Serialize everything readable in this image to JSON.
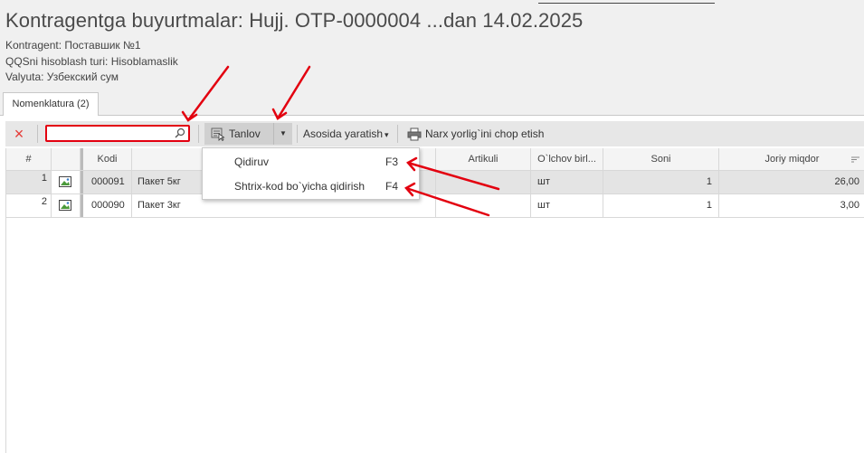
{
  "window": {
    "title": "Kontragentga buyurtmalar: Hujj. OTP-0000004 ...dan 14.02.2025"
  },
  "info": {
    "contragent": "Kontragent: Поставшик №1",
    "calc_type": "QQSni hisoblash turi: Hisoblamaslik",
    "currency": "Valyuta: Узбекский сум"
  },
  "tabs": [
    {
      "label": "Nomenklatura (2)",
      "active": true
    }
  ],
  "toolbar": {
    "delete_icon": "×",
    "search": {
      "value": "",
      "placeholder": ""
    },
    "tanlov_label": "Tanlov",
    "tanlov_arrow": "▼",
    "asosida_label": "Asosida yaratish",
    "asosida_arrow": "▾",
    "narx_label": "Narx yorlig`ini chop etish"
  },
  "dropdown": {
    "items": [
      {
        "label": "Qidiruv",
        "shortcut": "F3"
      },
      {
        "label": "Shtrix-kod bo`yicha qidirish",
        "shortcut": "F4"
      }
    ]
  },
  "table": {
    "columns": {
      "num": "#",
      "image": "",
      "kodi": "Kodi",
      "name": "",
      "artikuli": "Artikuli",
      "unit": "O`lchov birl...",
      "soni": "Soni",
      "miqdor": "Joriy miqdor"
    },
    "rows": [
      {
        "num": "1",
        "kodi": "000091",
        "name": "Пакет 5кг",
        "artikuli": "",
        "unit": "шт",
        "soni": "1",
        "miqdor": "26,00",
        "selected": true
      },
      {
        "num": "2",
        "kodi": "000090",
        "name": "Пакет 3кг",
        "artikuli": "",
        "unit": "шт",
        "soni": "1",
        "miqdor": "3,00",
        "selected": false
      }
    ]
  },
  "colors": {
    "annotation_red": "#e3000f",
    "delete_red": "#e53935",
    "toolbar_bg": "#e7e7e7",
    "selected_row": "#e4e4e4"
  }
}
